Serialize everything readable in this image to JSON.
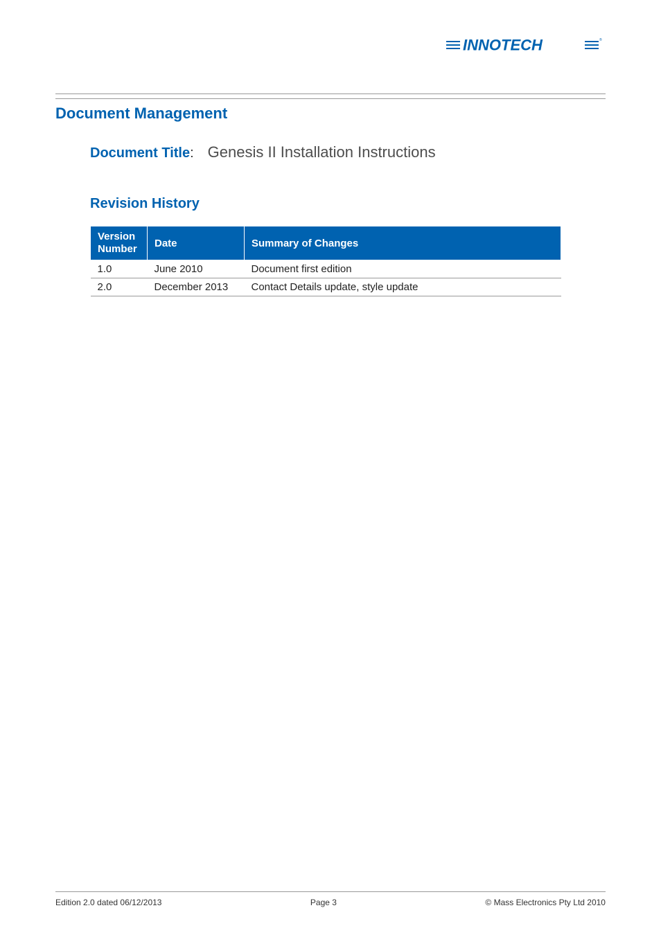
{
  "logo": {
    "text": "INNOTECH"
  },
  "section": {
    "title": "Document Management"
  },
  "docTitle": {
    "label": "Document Title",
    "value": "Genesis II Installation Instructions"
  },
  "revisionHistory": {
    "title": "Revision History",
    "headers": {
      "version": "Version Number",
      "date": "Date",
      "summary": "Summary of Changes"
    },
    "rows": [
      {
        "version": "1.0",
        "date": "June 2010",
        "summary": "Document first edition"
      },
      {
        "version": "2.0",
        "date": "December 2013",
        "summary": "Contact Details update, style update"
      }
    ]
  },
  "footer": {
    "left": "Edition 2.0 dated 06/12/2013",
    "center": "Page 3",
    "right": "©  Mass Electronics Pty Ltd  2010"
  }
}
